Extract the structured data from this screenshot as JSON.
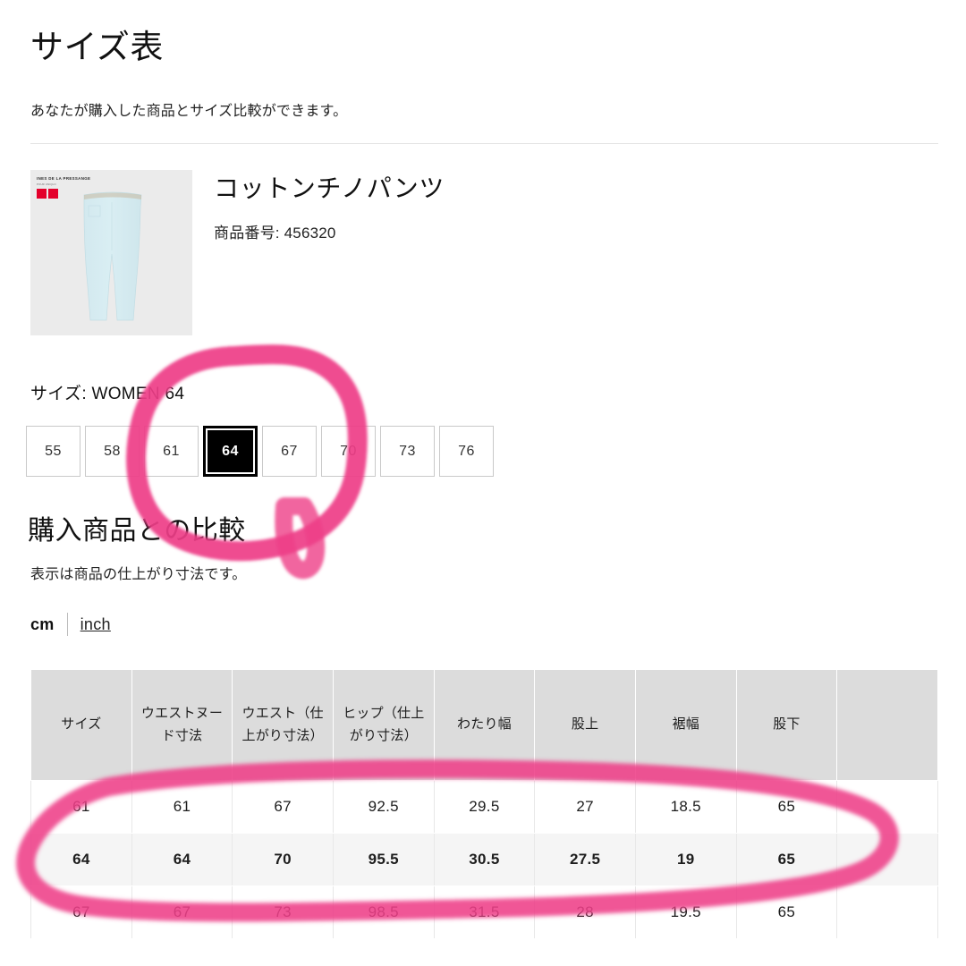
{
  "header": {
    "title": "サイズ表",
    "subtitle": "あなたが購入した商品とサイズ比較ができます。"
  },
  "product": {
    "name": "コットンチノパンツ",
    "code_label": "商品番号: 456320",
    "thumbnail": {
      "brand": "INES DE LA PRESSANGE",
      "brand_sub": "POUR UNIQLO",
      "alt": "light-blue-chino-pants"
    }
  },
  "size_selector": {
    "label": "サイズ: WOMEN 64",
    "selected": "64",
    "options": [
      "55",
      "58",
      "61",
      "64",
      "67",
      "70",
      "73",
      "76"
    ]
  },
  "comparison": {
    "heading": "購入商品との比較",
    "note": "表示は商品の仕上がり寸法です。",
    "unit_active": "cm",
    "unit_alternate": "inch"
  },
  "chart_data": {
    "type": "table",
    "title": "購入商品との比較",
    "columns": [
      "サイズ",
      "ウエストヌード寸法",
      "ウエスト（仕上がり寸法）",
      "ヒップ（仕上がり寸法）",
      "わたり幅",
      "股上",
      "裾幅",
      "股下",
      ""
    ],
    "rows": [
      {
        "highlighted": false,
        "cells": [
          "61",
          "61",
          "67",
          "92.5",
          "29.5",
          "27",
          "18.5",
          "65",
          ""
        ]
      },
      {
        "highlighted": true,
        "cells": [
          "64",
          "64",
          "70",
          "95.5",
          "30.5",
          "27.5",
          "19",
          "65",
          ""
        ]
      },
      {
        "highlighted": false,
        "cells": [
          "67",
          "67",
          "73",
          "98.5",
          "31.5",
          "28",
          "19.5",
          "65",
          ""
        ]
      }
    ],
    "unit": "cm"
  },
  "annotations": {
    "marker_color": "#ee3d87",
    "shapes": [
      {
        "name": "circle-around-size-64-chip",
        "kind": "ellipse"
      },
      {
        "name": "ellipse-around-row-64",
        "kind": "ellipse"
      }
    ]
  },
  "colors": {
    "header_bg": "#dcdcdc",
    "row_highlight_bg": "#f5f5f5",
    "selected_chip_bg": "#000000",
    "marker_pink": "#ee3d87",
    "thumbnail_bg": "#ebebeb",
    "brand_red": "#e4002b"
  }
}
